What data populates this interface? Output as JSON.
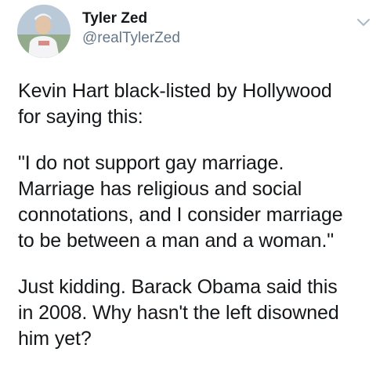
{
  "tweet": {
    "author": {
      "display_name": "Tyler Zed",
      "handle": "@realTylerZed",
      "avatar_icon": "profile-photo",
      "menu_icon": "chevron-down-icon"
    },
    "paragraphs": [
      "Kevin Hart black-listed by Hollywood\nfor saying this:",
      "\"I do not support gay marriage.\nMarriage has religious and social\nconnotations, and I consider marriage\nto be between a man and a woman.\"",
      "Just kidding. Barack Obama said this\nin 2008. Why hasn't the left disowned\nhim yet?"
    ]
  },
  "colors": {
    "text": "#14171a",
    "secondary_text": "#657786",
    "background": "#ffffff",
    "chevron": "#aab8c2"
  }
}
